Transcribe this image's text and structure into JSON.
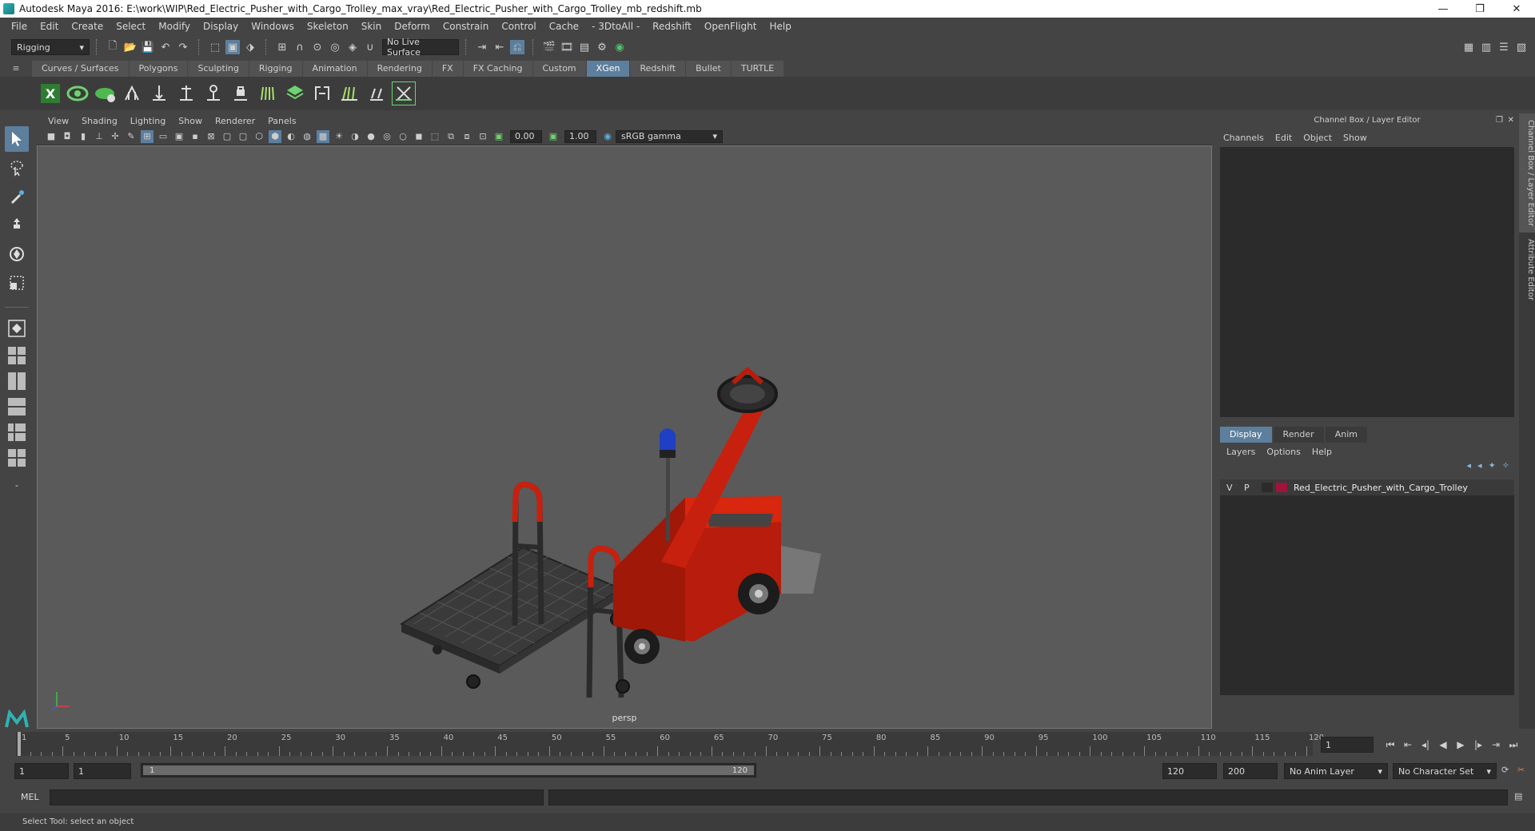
{
  "window": {
    "title": "Autodesk Maya 2016: E:\\work\\WIP\\Red_Electric_Pusher_with_Cargo_Trolley_max_vray\\Red_Electric_Pusher_with_Cargo_Trolley_mb_redshift.mb",
    "minimize": "—",
    "restore": "❐",
    "close": "✕"
  },
  "menus": [
    "File",
    "Edit",
    "Create",
    "Select",
    "Modify",
    "Display",
    "Windows",
    "Skeleton",
    "Skin",
    "Deform",
    "Constrain",
    "Control",
    "Cache",
    "- 3DtoAll -",
    "Redshift",
    "OpenFlight",
    "Help"
  ],
  "statusline": {
    "mode": "Rigging",
    "live_surface": "No Live Surface"
  },
  "shelf": {
    "tabs": [
      "Curves / Surfaces",
      "Polygons",
      "Sculpting",
      "Rigging",
      "Animation",
      "Rendering",
      "FX",
      "FX Caching",
      "Custom",
      "XGen",
      "Redshift",
      "Bullet",
      "TURTLE"
    ],
    "active_tab": "XGen"
  },
  "viewport": {
    "menus": [
      "View",
      "Shading",
      "Lighting",
      "Show",
      "Renderer",
      "Panels"
    ],
    "exposure": "0.00",
    "gamma": "1.00",
    "color_space": "sRGB gamma",
    "camera": "persp"
  },
  "right_panel": {
    "header": "Channel Box / Layer Editor",
    "channel_menus": [
      "Channels",
      "Edit",
      "Object",
      "Show"
    ],
    "layer_tabs": [
      "Display",
      "Render",
      "Anim"
    ],
    "active_layer_tab": "Display",
    "layer_menus": [
      "Layers",
      "Options",
      "Help"
    ],
    "layer": {
      "visible": "V",
      "playback": "P",
      "name": "Red_Electric_Pusher_with_Cargo_Trolley",
      "color": "#a0143c"
    },
    "side_tabs": [
      "Channel Box / Layer Editor",
      "Attribute Editor"
    ]
  },
  "timeline": {
    "ticks": [
      "1",
      "5",
      "10",
      "15",
      "20",
      "25",
      "30",
      "35",
      "40",
      "45",
      "50",
      "55",
      "60",
      "65",
      "70",
      "75",
      "80",
      "85",
      "90",
      "95",
      "100",
      "105",
      "110",
      "115",
      "120"
    ],
    "current_frame": "1"
  },
  "range": {
    "start": "1",
    "playback_start": "1",
    "slider_start": "1",
    "slider_end": "120",
    "playback_end": "120",
    "end": "200",
    "anim_layer": "No Anim Layer",
    "character_set": "No Character Set"
  },
  "cmdline": {
    "label": "MEL"
  },
  "helpline": {
    "text": "Select Tool: select an object"
  },
  "colors": {
    "accent": "#5d7f9e",
    "vehicle_red": "#c8200e",
    "beacon_blue": "#1f3fc4"
  }
}
